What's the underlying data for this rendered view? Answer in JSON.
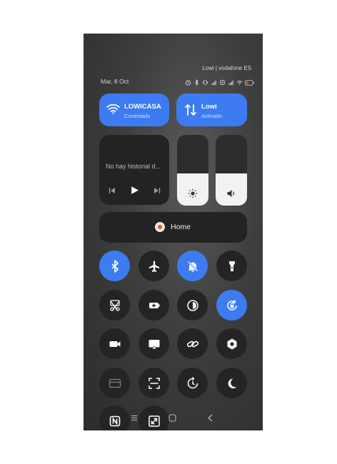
{
  "status_bar": {
    "carrier": "Lowi | vodafone ES",
    "date": "Mar, 8 Oct"
  },
  "wifi_tile": {
    "title": "LOWICASA",
    "subtitle": "Conectado",
    "icon": "wifi-icon"
  },
  "data_tile": {
    "title": "Lowi",
    "subtitle": "Activado",
    "icon": "mobile-data-icon"
  },
  "media": {
    "text": "No hay historial d...",
    "controls": [
      "previous-icon",
      "play-icon",
      "next-icon"
    ]
  },
  "sliders": [
    {
      "name": "brightness",
      "icon": "sun-icon",
      "level": 0.45
    },
    {
      "name": "volume",
      "icon": "volume-icon",
      "level": 0.45
    }
  ],
  "home_tile": {
    "label": "Home"
  },
  "toggles": [
    {
      "icon": "bluetooth-icon",
      "active": true
    },
    {
      "icon": "airplane-icon",
      "active": false
    },
    {
      "icon": "silent-icon",
      "active": true
    },
    {
      "icon": "flashlight-icon",
      "active": false
    },
    {
      "icon": "screenshot-icon",
      "active": false
    },
    {
      "icon": "battery-saver-icon",
      "active": false
    },
    {
      "icon": "dark-contrast-icon",
      "active": false
    },
    {
      "icon": "rotation-lock-icon",
      "active": true
    },
    {
      "icon": "video-icon",
      "active": false
    },
    {
      "icon": "cast-icon",
      "active": false
    },
    {
      "icon": "link-icon",
      "active": false
    },
    {
      "icon": "settings-icon",
      "active": false
    },
    {
      "icon": "card-icon",
      "active": false
    },
    {
      "icon": "scan-icon",
      "active": false
    },
    {
      "icon": "sync-icon",
      "active": false
    },
    {
      "icon": "night-mode-icon",
      "active": false
    },
    {
      "icon": "nfc-icon",
      "active": false
    },
    {
      "icon": "expand-icon",
      "active": false
    }
  ],
  "nav_bar": {
    "icons": [
      "menu-icon",
      "home-nav-icon",
      "back-icon"
    ]
  },
  "colors": {
    "accent": "#3d7cf0",
    "tile_dark": "#232323",
    "background": "#3e3e3e"
  }
}
